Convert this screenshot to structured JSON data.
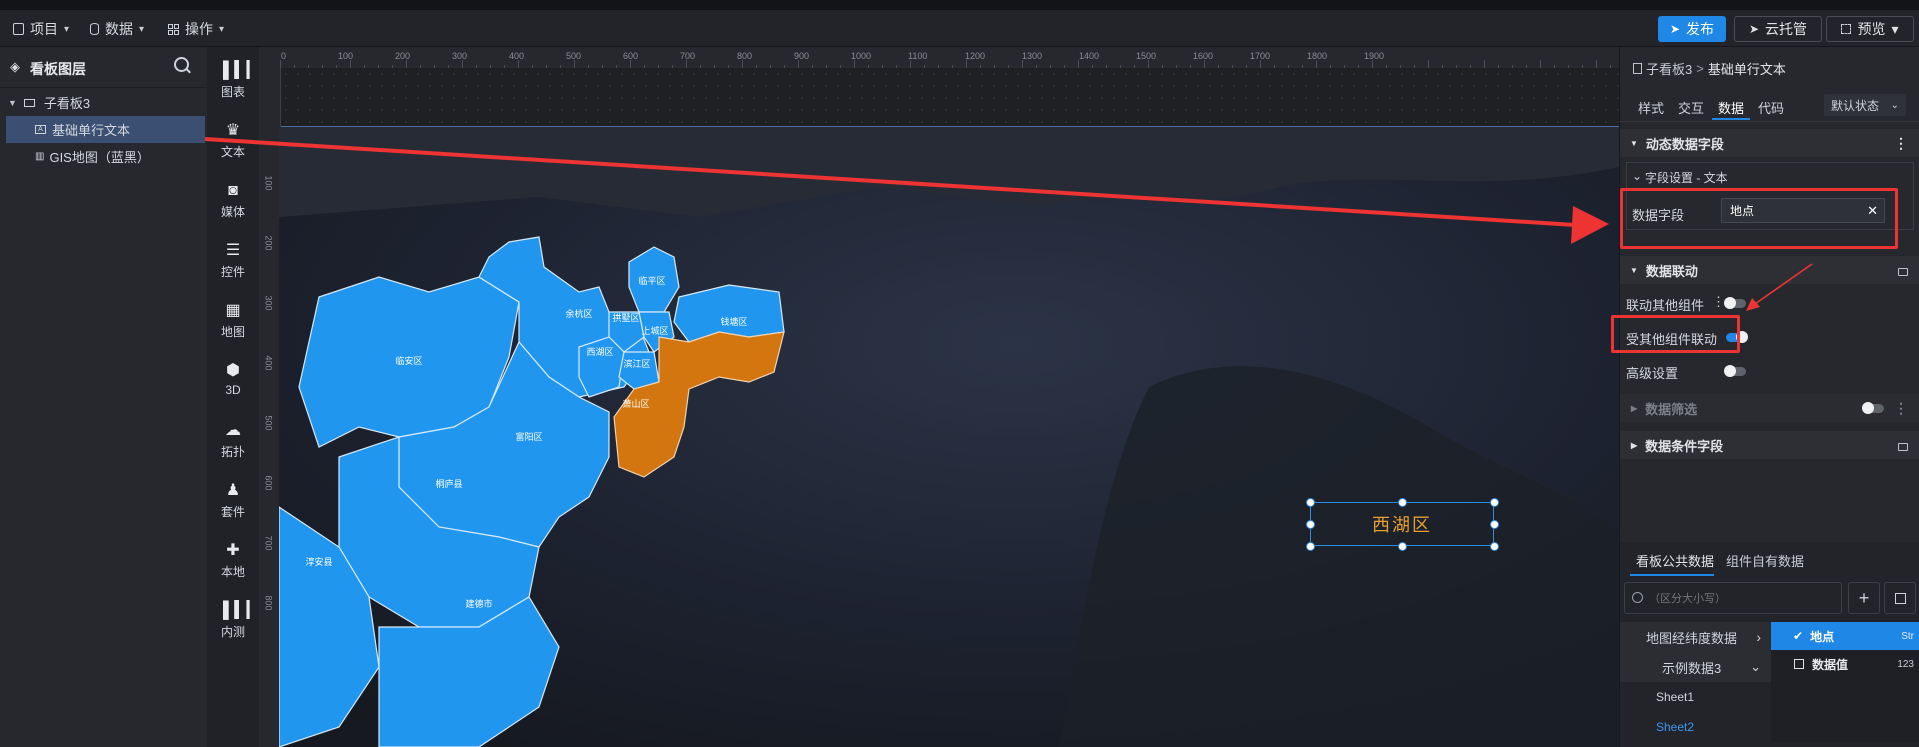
{
  "toolbar": {
    "menus": [
      {
        "label": "项目",
        "icon": "document-icon"
      },
      {
        "label": "数据",
        "icon": "database-icon"
      },
      {
        "label": "操作",
        "icon": "grid-icon"
      }
    ],
    "publish_label": "发布",
    "cloud_label": "云托管",
    "preview_label": "预览",
    "accent": "#1f87e5"
  },
  "layer_panel": {
    "title": "看板图层",
    "items": [
      {
        "label": "子看板3",
        "icon": "monitor-icon"
      },
      {
        "label": "基础单行文本",
        "icon": "text-icon"
      },
      {
        "label": "GIS地图（蓝黑）",
        "icon": "map-icon"
      }
    ]
  },
  "rail": {
    "items": [
      {
        "label": "图表",
        "icon": "chart-icon"
      },
      {
        "label": "文本",
        "icon": "crown-icon"
      },
      {
        "label": "媒体",
        "icon": "camera-icon"
      },
      {
        "label": "控件",
        "icon": "layers-icon"
      },
      {
        "label": "地图",
        "icon": "map-icon"
      },
      {
        "label": "3D",
        "icon": "cube-icon"
      },
      {
        "label": "拓扑",
        "icon": "topology-icon"
      },
      {
        "label": "套件",
        "icon": "shirt-icon"
      },
      {
        "label": "本地",
        "icon": "puzzle-icon"
      },
      {
        "label": "内测",
        "icon": "chart-icon"
      }
    ]
  },
  "canvas": {
    "ruler_top": [
      "0",
      "100",
      "200",
      "300",
      "400",
      "500",
      "600",
      "700",
      "800",
      "900",
      "1000",
      "1100",
      "1200",
      "1300",
      "1400",
      "1500",
      "1600",
      "1700",
      "1800",
      "1900"
    ],
    "ruler_left": [
      "100",
      "200",
      "300",
      "400",
      "500",
      "600",
      "700",
      "800"
    ],
    "selected_text": "西湖区",
    "selected_text_color": "#e8a033",
    "map": {
      "regions_blue_color": "#2196ee",
      "region_highlight_color": "#d4760f",
      "labels": [
        "临安区",
        "余杭区",
        "临平区",
        "拱墅区",
        "上城区",
        "钱塘区",
        "西湖区",
        "滨江区",
        "萧山区",
        "富阳区",
        "桐庐县",
        "淳安县",
        "建德市"
      ]
    }
  },
  "props": {
    "breadcrumb_parent": "子看板3",
    "breadcrumb_sep": ">",
    "breadcrumb_current": "基础单行文本",
    "tabs": [
      "样式",
      "交互",
      "数据",
      "代码"
    ],
    "active_tab": "数据",
    "state_select": "默认状态",
    "dynamic_section": "动态数据字段",
    "field_setting": "字段设置 - 文本",
    "data_field_label": "数据字段",
    "data_field_value": "地点",
    "linkage_section": "数据联动",
    "linkage_rows": [
      {
        "label": "联动其他组件",
        "on": false
      },
      {
        "label": "受其他组件联动",
        "on": true
      },
      {
        "label": "高级设置",
        "on": false
      }
    ],
    "filter_section": "数据筛选",
    "condition_section": "数据条件字段",
    "bottom_tabs": [
      "看板公共数据",
      "组件自有数据"
    ],
    "search_placeholder": "（区分大小写）",
    "datasets": [
      {
        "label": "地图经纬度数据",
        "chevron": "›"
      },
      {
        "label": "示例数据3",
        "chevron": "⌄"
      },
      {
        "label": "Sheet1"
      },
      {
        "label": "Sheet2",
        "active": true
      }
    ],
    "fields": [
      {
        "label": "地点",
        "type": "Str",
        "checked": true
      },
      {
        "label": "数据值",
        "type": "123",
        "checked": false
      }
    ]
  }
}
